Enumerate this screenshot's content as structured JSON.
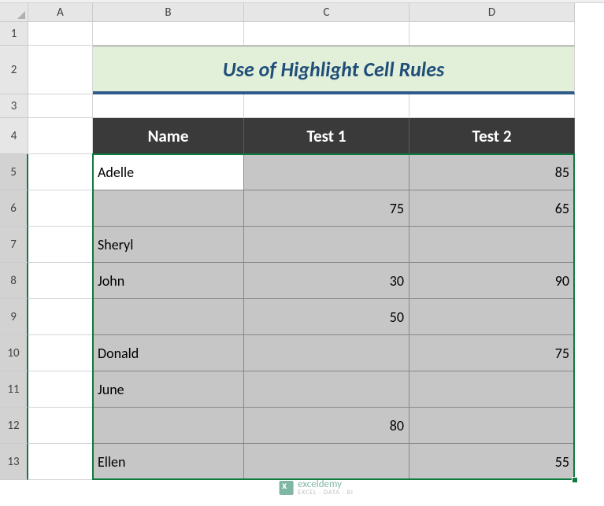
{
  "columns": [
    "A",
    "B",
    "C",
    "D"
  ],
  "rows": [
    "1",
    "2",
    "3",
    "4",
    "5",
    "6",
    "7",
    "8",
    "9",
    "10",
    "11",
    "12",
    "13"
  ],
  "title": "Use of Highlight Cell Rules",
  "table_headers": {
    "name": "Name",
    "test1": "Test 1",
    "test2": "Test 2"
  },
  "data": [
    {
      "name": "Adelle",
      "test1": "",
      "test2": "85"
    },
    {
      "name": "",
      "test1": "75",
      "test2": "65"
    },
    {
      "name": "Sheryl",
      "test1": "",
      "test2": ""
    },
    {
      "name": "John",
      "test1": "30",
      "test2": "90"
    },
    {
      "name": "",
      "test1": "50",
      "test2": ""
    },
    {
      "name": "Donald",
      "test1": "",
      "test2": "75"
    },
    {
      "name": "June",
      "test1": "",
      "test2": ""
    },
    {
      "name": "",
      "test1": "80",
      "test2": ""
    },
    {
      "name": "Ellen",
      "test1": "",
      "test2": "55"
    }
  ],
  "watermark": {
    "brand": "exceldemy",
    "tagline": "EXCEL · DATA · BI"
  },
  "chart_data": {
    "type": "table",
    "title": "Use of Highlight Cell Rules",
    "columns": [
      "Name",
      "Test 1",
      "Test 2"
    ],
    "rows": [
      [
        "Adelle",
        null,
        85
      ],
      [
        null,
        75,
        65
      ],
      [
        "Sheryl",
        null,
        null
      ],
      [
        "John",
        30,
        90
      ],
      [
        null,
        50,
        null
      ],
      [
        "Donald",
        null,
        75
      ],
      [
        "June",
        null,
        null
      ],
      [
        null,
        80,
        null
      ],
      [
        "Ellen",
        null,
        55
      ]
    ]
  }
}
